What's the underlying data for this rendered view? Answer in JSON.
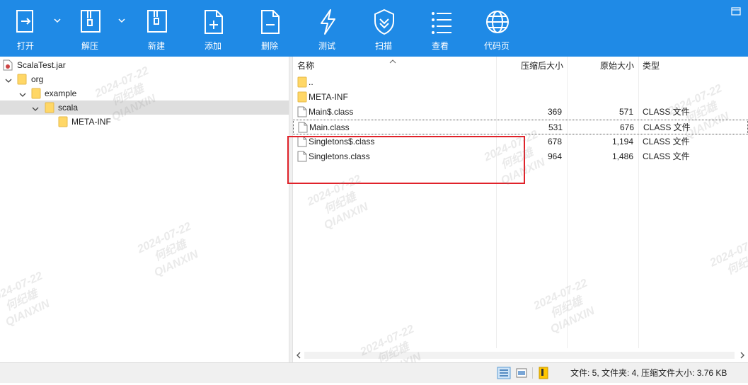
{
  "toolbar": {
    "bg": "#1f8ae6",
    "buttons": [
      {
        "label": "打开",
        "icon": "open-icon",
        "has_dropdown": true
      },
      {
        "label": "解压",
        "icon": "extract-icon",
        "has_dropdown": true
      },
      {
        "label": "新建",
        "icon": "new-archive-icon"
      },
      {
        "label": "添加",
        "icon": "add-file-icon"
      },
      {
        "label": "删除",
        "icon": "delete-file-icon"
      },
      {
        "label": "测试",
        "icon": "test-lightning-icon"
      },
      {
        "label": "扫描",
        "icon": "scan-shield-icon"
      },
      {
        "label": "查看",
        "icon": "view-list-icon"
      },
      {
        "label": "代码页",
        "icon": "codepage-globe-icon"
      }
    ]
  },
  "tree": {
    "items": [
      {
        "label": "ScalaTest.jar",
        "icon": "jar-file-icon",
        "expanded": null,
        "selected": false
      },
      {
        "label": "org",
        "icon": "folder-icon",
        "expanded": true,
        "selected": false
      },
      {
        "label": "example",
        "icon": "folder-icon",
        "expanded": true,
        "selected": false
      },
      {
        "label": "scala",
        "icon": "folder-icon",
        "expanded": true,
        "selected": true
      },
      {
        "label": "META-INF",
        "icon": "folder-icon",
        "expanded": null,
        "selected": false
      }
    ]
  },
  "list": {
    "columns": {
      "name": "名称",
      "compressed": "压缩后大小",
      "original": "原始大小",
      "type": "类型"
    },
    "rows": [
      {
        "name": "..",
        "icon": "folder-icon",
        "compressed": "",
        "original": "",
        "type": ""
      },
      {
        "name": "META-INF",
        "icon": "folder-icon",
        "compressed": "",
        "original": "",
        "type": ""
      },
      {
        "name": "Main$.class",
        "icon": "file-icon",
        "compressed": "369",
        "original": "571",
        "type": "CLASS 文件"
      },
      {
        "name": "Main.class",
        "icon": "file-icon",
        "compressed": "531",
        "original": "676",
        "type": "CLASS 文件",
        "focused": true
      },
      {
        "name": "Singletons$.class",
        "icon": "file-icon",
        "compressed": "678",
        "original": "1,194",
        "type": "CLASS 文件"
      },
      {
        "name": "Singletons.class",
        "icon": "file-icon",
        "compressed": "964",
        "original": "1,486",
        "type": "CLASS 文件"
      }
    ]
  },
  "status": {
    "text": "文件: 5, 文件夹: 4, 压缩文件大小: 3.76 KB"
  },
  "watermark": {
    "date": "2024-07-22",
    "name": "何纪雄",
    "org": "QIANXIN"
  },
  "colors": {
    "highlight_box": "#e0222a",
    "folder": "#ffd766"
  }
}
